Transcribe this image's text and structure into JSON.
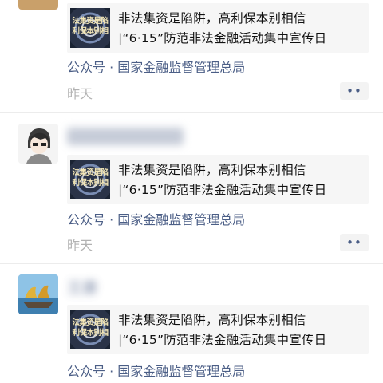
{
  "posts": [
    {
      "article_title": "非法集资是陷阱，高利保本别相信 |“6·15”防范非法金融活动集中宣传日",
      "thumb_text_1": "法集资是陷",
      "thumb_text_2": "利保本别相",
      "source": "公众号 · 国家金融监督管理总局",
      "time": "昨天",
      "more": "••"
    },
    {
      "name": "",
      "article_title": "非法集资是陷阱，高利保本别相信 |“6·15”防范非法金融活动集中宣传日",
      "thumb_text_1": "法集资是陷",
      "thumb_text_2": "利保本别相",
      "source": "公众号 · 国家金融监督管理总局",
      "time": "昨天",
      "more": "••"
    },
    {
      "name": "王康",
      "article_title": "非法集资是陷阱，高利保本别相信 |“6·15”防范非法金融活动集中宣传日",
      "thumb_text_1": "法集资是陷",
      "thumb_text_2": "利保本别相",
      "source": "公众号 · 国家金融监督管理总局"
    }
  ],
  "colors": {
    "link": "#4b5e86",
    "time": "#b2b2b2",
    "card_bg": "#f6f6f6",
    "divider": "#ececec"
  }
}
